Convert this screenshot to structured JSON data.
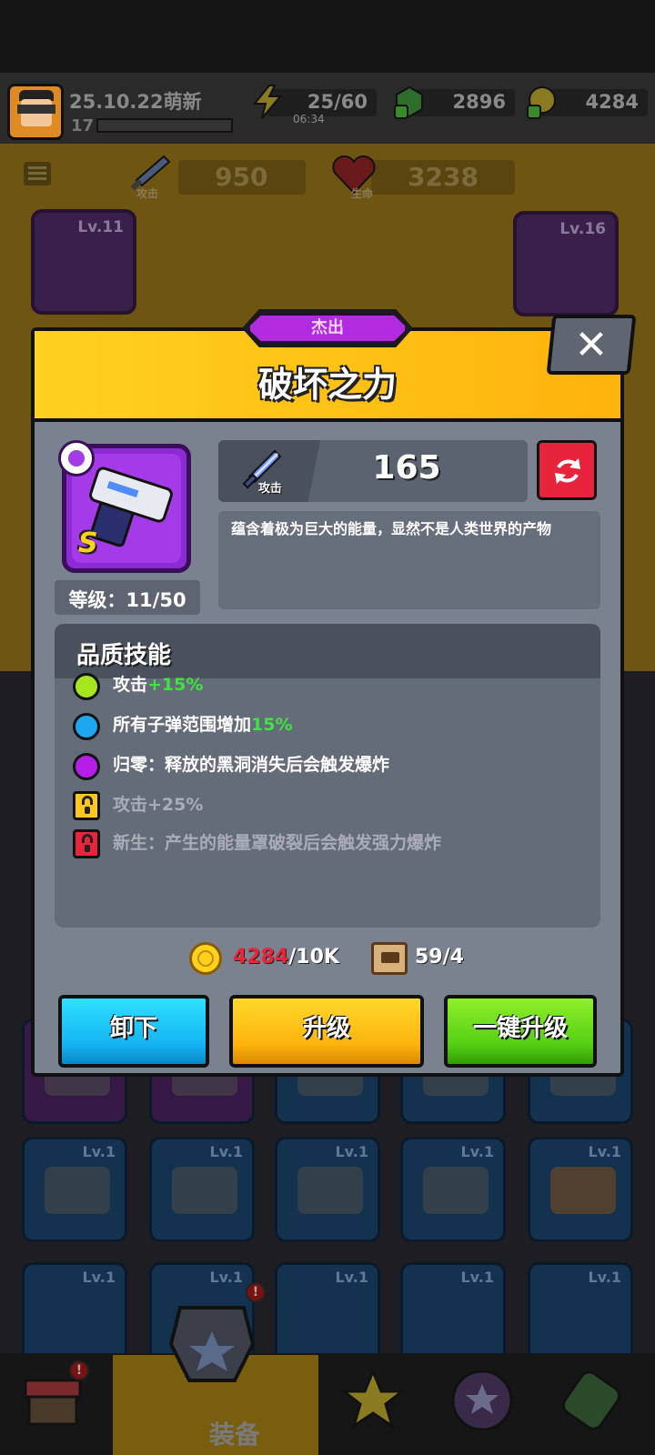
{
  "header": {
    "player_name": "25.10.22萌新",
    "player_level": "17",
    "energy": "25/60",
    "energy_timer": "06:34",
    "gems": "2896",
    "gold": "4284"
  },
  "stats": {
    "attack_value": "950",
    "attack_label": "攻击",
    "hp_value": "3238",
    "hp_label": "生命"
  },
  "equipped_slots": [
    {
      "level": "Lv.11",
      "grade": "S"
    },
    {
      "level": "Lv.16"
    }
  ],
  "inventory_levels": [
    "Lv.1",
    "Lv.1",
    "Lv.1",
    "Lv.1",
    "Lv.1",
    "Lv.1",
    "Lv.1",
    "Lv.1",
    "Lv.1",
    "Lv.1"
  ],
  "bottom_nav": {
    "active_label": "装备"
  },
  "modal": {
    "quality_tag": "杰出",
    "title": "破坏之力",
    "close_label": "✕",
    "grade": "S",
    "level_text": "等级：11/50",
    "attack_label": "攻击",
    "attack_value": "165",
    "description": "蕴含着极为巨大的能量，显然不是人类世界的产物",
    "skills_title": "品质技能",
    "skills": [
      {
        "prefix": "攻击",
        "highlight": "+15%",
        "color": "#a6e61c",
        "locked": false
      },
      {
        "prefix": "所有子弹范围增加",
        "highlight": "15%",
        "color": "#1ea6f0",
        "locked": false
      },
      {
        "prefix": "归零：释放的黑洞消失后会触发爆炸",
        "highlight": "",
        "color": "#b41ee6",
        "locked": false
      },
      {
        "prefix": "攻击+25%",
        "highlight": "",
        "color": "#ffc81e",
        "locked": true
      },
      {
        "prefix": "新生：产生的能量罩破裂后会触发强力爆炸",
        "highlight": "",
        "color": "#e8243c",
        "locked": true
      }
    ],
    "cost": {
      "gold_have": "4284",
      "gold_need": "/10K",
      "parts": "59/4"
    },
    "buttons": {
      "unequip": "卸下",
      "upgrade": "升级",
      "upgrade_all": "一键升级"
    }
  },
  "colors": {
    "quality_purple": "#b12be0",
    "header_yellow": "#ffc81e",
    "panel_gray": "#7a8290",
    "shortfall_red": "#e82438",
    "bonus_green": "#3ce63c"
  }
}
